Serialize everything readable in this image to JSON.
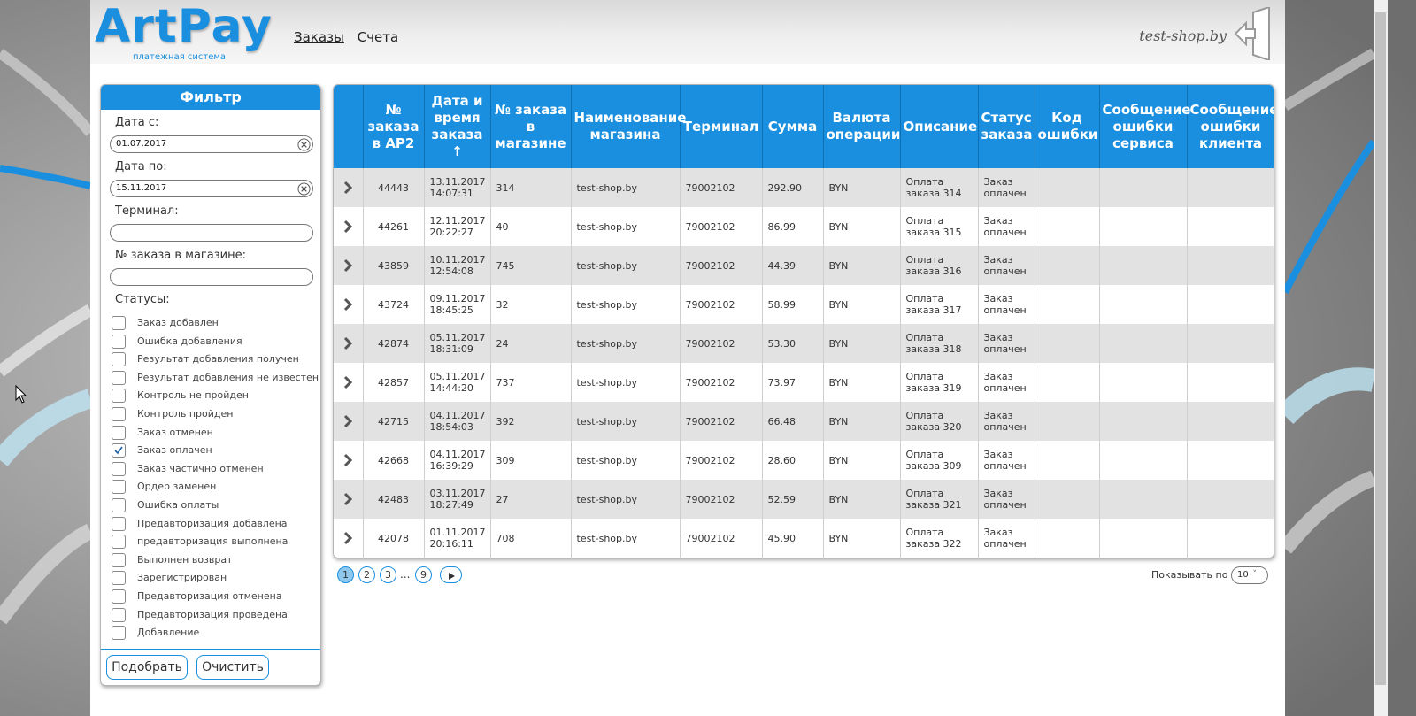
{
  "brand": {
    "logo": "ArtPay",
    "tagline": "платежная система",
    "accent": "#1a8fdf"
  },
  "nav": {
    "items": [
      {
        "label": "Заказы",
        "active": true
      },
      {
        "label": "Счета",
        "active": false
      }
    ],
    "shop": "test-shop.by",
    "exit_icon": "exit-door-icon"
  },
  "filter": {
    "title": "Фильтр",
    "date_from_label": "Дата с:",
    "date_from_value": "01.07.2017",
    "date_to_label": "Дата по:",
    "date_to_value": "15.11.2017",
    "terminal_label": "Терминал:",
    "terminal_value": "",
    "order_label": "№ заказа в магазине:",
    "order_value": "",
    "statuses_label": "Статусы:",
    "statuses": [
      {
        "label": "Заказ добавлен",
        "checked": false
      },
      {
        "label": "Ошибка добавления",
        "checked": false
      },
      {
        "label": "Результат добавления получен",
        "checked": false
      },
      {
        "label": "Результат добавления не известен",
        "checked": false
      },
      {
        "label": "Контроль не пройден",
        "checked": false
      },
      {
        "label": "Контроль пройден",
        "checked": false
      },
      {
        "label": "Заказ отменен",
        "checked": false
      },
      {
        "label": "Заказ оплачен",
        "checked": true
      },
      {
        "label": "Заказ частично отменен",
        "checked": false
      },
      {
        "label": "Ордер заменен",
        "checked": false
      },
      {
        "label": "Ошибка оплаты",
        "checked": false
      },
      {
        "label": "Предавторизация добавлена",
        "checked": false
      },
      {
        "label": "предавторизация выполнена",
        "checked": false
      },
      {
        "label": "Выполнен возврат",
        "checked": false
      },
      {
        "label": "Зарегистрирован",
        "checked": false
      },
      {
        "label": "Предавторизация отменена",
        "checked": false
      },
      {
        "label": "Предавторизация проведена",
        "checked": false
      },
      {
        "label": "Добавление",
        "checked": false
      }
    ],
    "apply_label": "Подобрать",
    "clear_label": "Очистить"
  },
  "table": {
    "columns": [
      "",
      "№ заказа в AP2",
      "Дата и время заказа ↑",
      "№ заказа в магазине",
      "Наименование магазина",
      "Терминал",
      "Сумма",
      "Валюта операции",
      "Описание",
      "Статус заказа",
      "Код ошибки",
      "Сообщение ошибки сервиса",
      "Сообщение ошибки клиента"
    ],
    "rows": [
      {
        "ap2": "44443",
        "date": "13.11.2017",
        "time": "14:07:31",
        "shop_order": "314",
        "shop": "test-shop.by",
        "terminal": "79002102",
        "amount": "292.90",
        "currency": "BYN",
        "desc1": "Оплата",
        "desc2": "заказа 314",
        "status1": "Заказ",
        "status2": "оплачен",
        "code": "",
        "service_msg": "",
        "client_msg": ""
      },
      {
        "ap2": "44261",
        "date": "12.11.2017",
        "time": "20:22:27",
        "shop_order": "40",
        "shop": "test-shop.by",
        "terminal": "79002102",
        "amount": "86.99",
        "currency": "BYN",
        "desc1": "Оплата",
        "desc2": "заказа 315",
        "status1": "Заказ",
        "status2": "оплачен",
        "code": "",
        "service_msg": "",
        "client_msg": ""
      },
      {
        "ap2": "43859",
        "date": "10.11.2017",
        "time": "12:54:08",
        "shop_order": "745",
        "shop": "test-shop.by",
        "terminal": "79002102",
        "amount": "44.39",
        "currency": "BYN",
        "desc1": "Оплата",
        "desc2": "заказа 316",
        "status1": "Заказ",
        "status2": "оплачен",
        "code": "",
        "service_msg": "",
        "client_msg": ""
      },
      {
        "ap2": "43724",
        "date": "09.11.2017",
        "time": "18:45:25",
        "shop_order": "32",
        "shop": "test-shop.by",
        "terminal": "79002102",
        "amount": "58.99",
        "currency": "BYN",
        "desc1": "Оплата",
        "desc2": "заказа 317",
        "status1": "Заказ",
        "status2": "оплачен",
        "code": "",
        "service_msg": "",
        "client_msg": ""
      },
      {
        "ap2": "42874",
        "date": "05.11.2017",
        "time": "18:31:09",
        "shop_order": "24",
        "shop": "test-shop.by",
        "terminal": "79002102",
        "amount": "53.30",
        "currency": "BYN",
        "desc1": "Оплата",
        "desc2": "заказа 318",
        "status1": "Заказ",
        "status2": "оплачен",
        "code": "",
        "service_msg": "",
        "client_msg": ""
      },
      {
        "ap2": "42857",
        "date": "05.11.2017",
        "time": "14:44:20",
        "shop_order": "737",
        "shop": "test-shop.by",
        "terminal": "79002102",
        "amount": "73.97",
        "currency": "BYN",
        "desc1": "Оплата",
        "desc2": "заказа 319",
        "status1": "Заказ",
        "status2": "оплачен",
        "code": "",
        "service_msg": "",
        "client_msg": ""
      },
      {
        "ap2": "42715",
        "date": "04.11.2017",
        "time": "18:54:03",
        "shop_order": "392",
        "shop": "test-shop.by",
        "terminal": "79002102",
        "amount": "66.48",
        "currency": "BYN",
        "desc1": "Оплата",
        "desc2": "заказа 320",
        "status1": "Заказ",
        "status2": "оплачен",
        "code": "",
        "service_msg": "",
        "client_msg": ""
      },
      {
        "ap2": "42668",
        "date": "04.11.2017",
        "time": "16:39:29",
        "shop_order": "309",
        "shop": "test-shop.by",
        "terminal": "79002102",
        "amount": "28.60",
        "currency": "BYN",
        "desc1": "Оплата",
        "desc2": "заказа 309",
        "status1": "Заказ",
        "status2": "оплачен",
        "code": "",
        "service_msg": "",
        "client_msg": ""
      },
      {
        "ap2": "42483",
        "date": "03.11.2017",
        "time": "18:27:49",
        "shop_order": "27",
        "shop": "test-shop.by",
        "terminal": "79002102",
        "amount": "52.59",
        "currency": "BYN",
        "desc1": "Оплата",
        "desc2": "заказа 321",
        "status1": "Заказ",
        "status2": "оплачен",
        "code": "",
        "service_msg": "",
        "client_msg": ""
      },
      {
        "ap2": "42078",
        "date": "01.11.2017",
        "time": "20:16:11",
        "shop_order": "708",
        "shop": "test-shop.by",
        "terminal": "79002102",
        "amount": "45.90",
        "currency": "BYN",
        "desc1": "Оплата",
        "desc2": "заказа 322",
        "status1": "Заказ",
        "status2": "оплачен",
        "code": "",
        "service_msg": "",
        "client_msg": ""
      }
    ]
  },
  "pagination": {
    "pages": [
      "1",
      "2",
      "3"
    ],
    "current": "1",
    "ellipsis": "...",
    "last": "9",
    "next_icon": "play-next-icon",
    "per_page_label": "Показывать по",
    "per_page_value": "10"
  }
}
